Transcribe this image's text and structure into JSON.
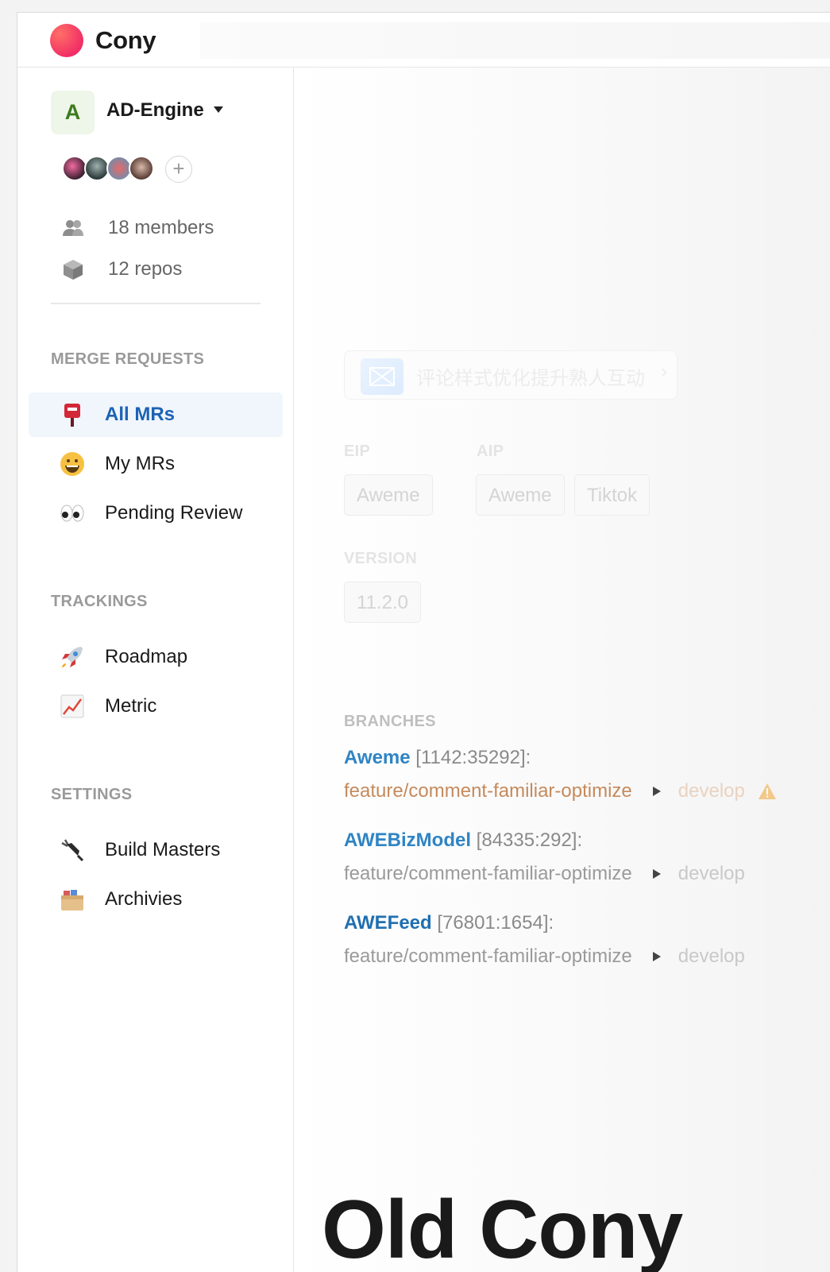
{
  "app": {
    "brand": "Cony"
  },
  "team": {
    "initial": "A",
    "name": "AD-Engine"
  },
  "stats": {
    "members": "18 members",
    "repos": "12 repos"
  },
  "add_member_symbol": "+",
  "sections": {
    "merge_requests": "MERGE REQUESTS",
    "trackings": "TRACKINGS",
    "settings": "SETTINGS"
  },
  "nav": {
    "all_mrs": {
      "label": "All MRs",
      "emoji": "📮"
    },
    "my_mrs": {
      "label": "My MRs",
      "emoji": "😀"
    },
    "pending_review": {
      "label": "Pending Review",
      "emoji": "👀"
    },
    "roadmap": {
      "label": "Roadmap",
      "emoji": "🚀"
    },
    "metric": {
      "label": "Metric",
      "emoji": "📈"
    },
    "build_masters": {
      "label": "Build Masters",
      "emoji": "🔌"
    },
    "archives": {
      "label": "Archivies",
      "emoji": "🗃️"
    }
  },
  "mr": {
    "title": "评论样式优化提升熟人互动",
    "arrow": "›",
    "eip_label": "EIP",
    "aip_label": "AIP",
    "eip_apps": [
      "Aweme"
    ],
    "aip_apps": [
      "Aweme",
      "Tiktok"
    ],
    "version_label": "VERSION",
    "version": "11.2.0"
  },
  "branches": {
    "title": "BRANCHES",
    "items": [
      {
        "repo": "Aweme",
        "meta": "[1142:35292]:",
        "source": "feature/comment-familiar-optimize",
        "target": "develop"
      },
      {
        "repo": "AWEBizModel",
        "meta": "[84335:292]:",
        "source": "feature/comment-familiar-optimize",
        "target": "develop"
      },
      {
        "repo": "AWEFeed",
        "meta": "[76801:1654]:",
        "source": "feature/comment-familiar-optimize",
        "target": "develop"
      }
    ]
  },
  "overlay_title": "Old Cony",
  "colors": {
    "brand_dot": "#f22f66",
    "active_nav_bg": "#f0f6fc",
    "active_nav_text": "#1d63b5",
    "repo_link": "#2f84c4",
    "conflict_branch": "#c58a5c",
    "warning": "#f2c98a"
  }
}
